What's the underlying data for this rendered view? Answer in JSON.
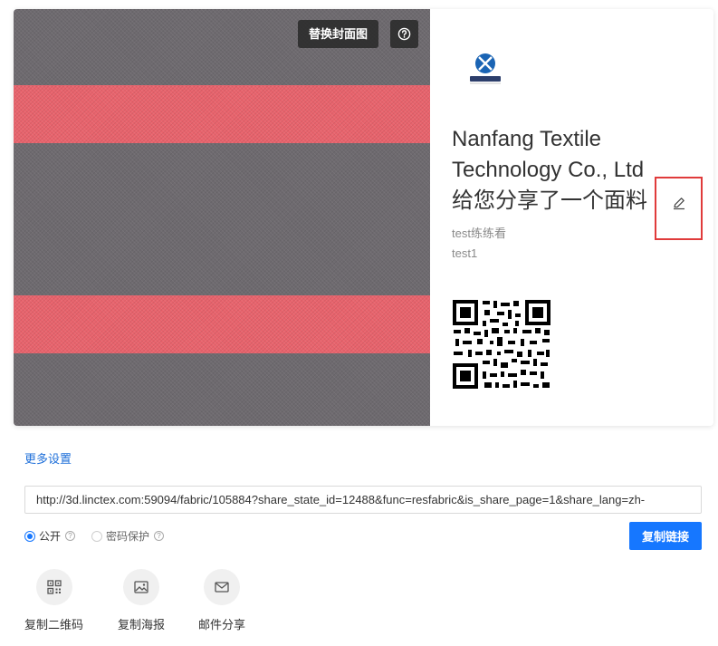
{
  "cover": {
    "replace_label": "替换封面图"
  },
  "share_card": {
    "company_line1": "Nanfang Textile",
    "company_line2": "Technology Co., Ltd",
    "share_text": "给您分享了一个面料",
    "desc_line1": "test练练看",
    "desc_line2": "test1"
  },
  "more_settings_label": "更多设置",
  "share_url": {
    "value": "http://3d.linctex.com:59094/fabric/105884?share_state_id=12488&func=resfabric&is_share_page=1&share_lang=zh-"
  },
  "visibility": {
    "options": [
      {
        "label": "公开",
        "checked": true
      },
      {
        "label": "密码保护",
        "checked": false
      }
    ]
  },
  "copy_link_label": "复制链接",
  "actions": [
    {
      "label": "复制二维码",
      "icon": "qr-code-icon"
    },
    {
      "label": "复制海报",
      "icon": "image-icon"
    },
    {
      "label": "邮件分享",
      "icon": "mail-icon"
    }
  ],
  "colors": {
    "accent": "#1677ff",
    "highlight": "#e03b3b",
    "fabric_base": "#6e6a6f",
    "fabric_stripe": "#e8636c"
  }
}
